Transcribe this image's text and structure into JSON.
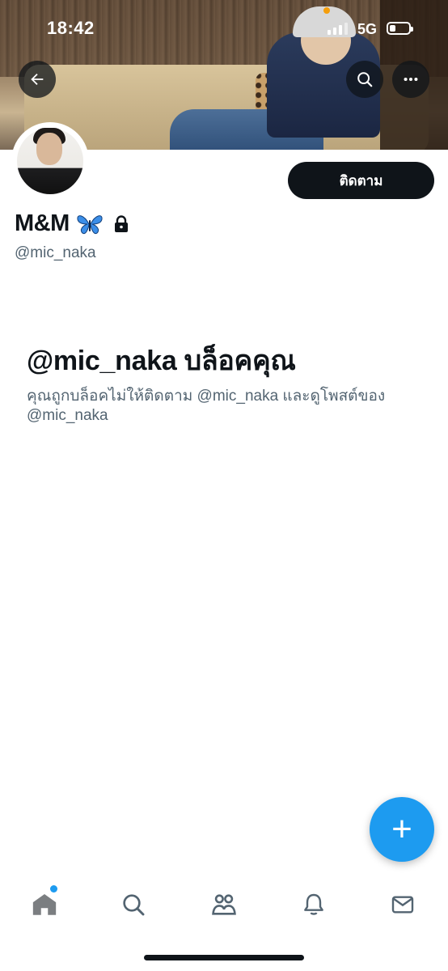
{
  "status_bar": {
    "time": "18:42",
    "network": "5G"
  },
  "profile": {
    "display_name": "M&M",
    "handle": "@mic_naka",
    "follow_label": "ติดตาม",
    "verified_emoji_icon": "butterfly-icon",
    "locked_icon": "lock-icon"
  },
  "blocked_notice": {
    "title": "@mic_naka บล็อคคุณ",
    "description": "คุณถูกบล็อคไม่ให้ติดตาม @mic_naka และดูโพสต์ของ @mic_naka"
  },
  "fab": {
    "label": "+"
  },
  "tabbar": {
    "items": [
      "home-icon",
      "search-icon",
      "communities-icon",
      "notifications-icon",
      "messages-icon"
    ]
  },
  "colors": {
    "accent": "#1d9bf0",
    "text": "#0f1419",
    "secondary_text": "#536471"
  }
}
